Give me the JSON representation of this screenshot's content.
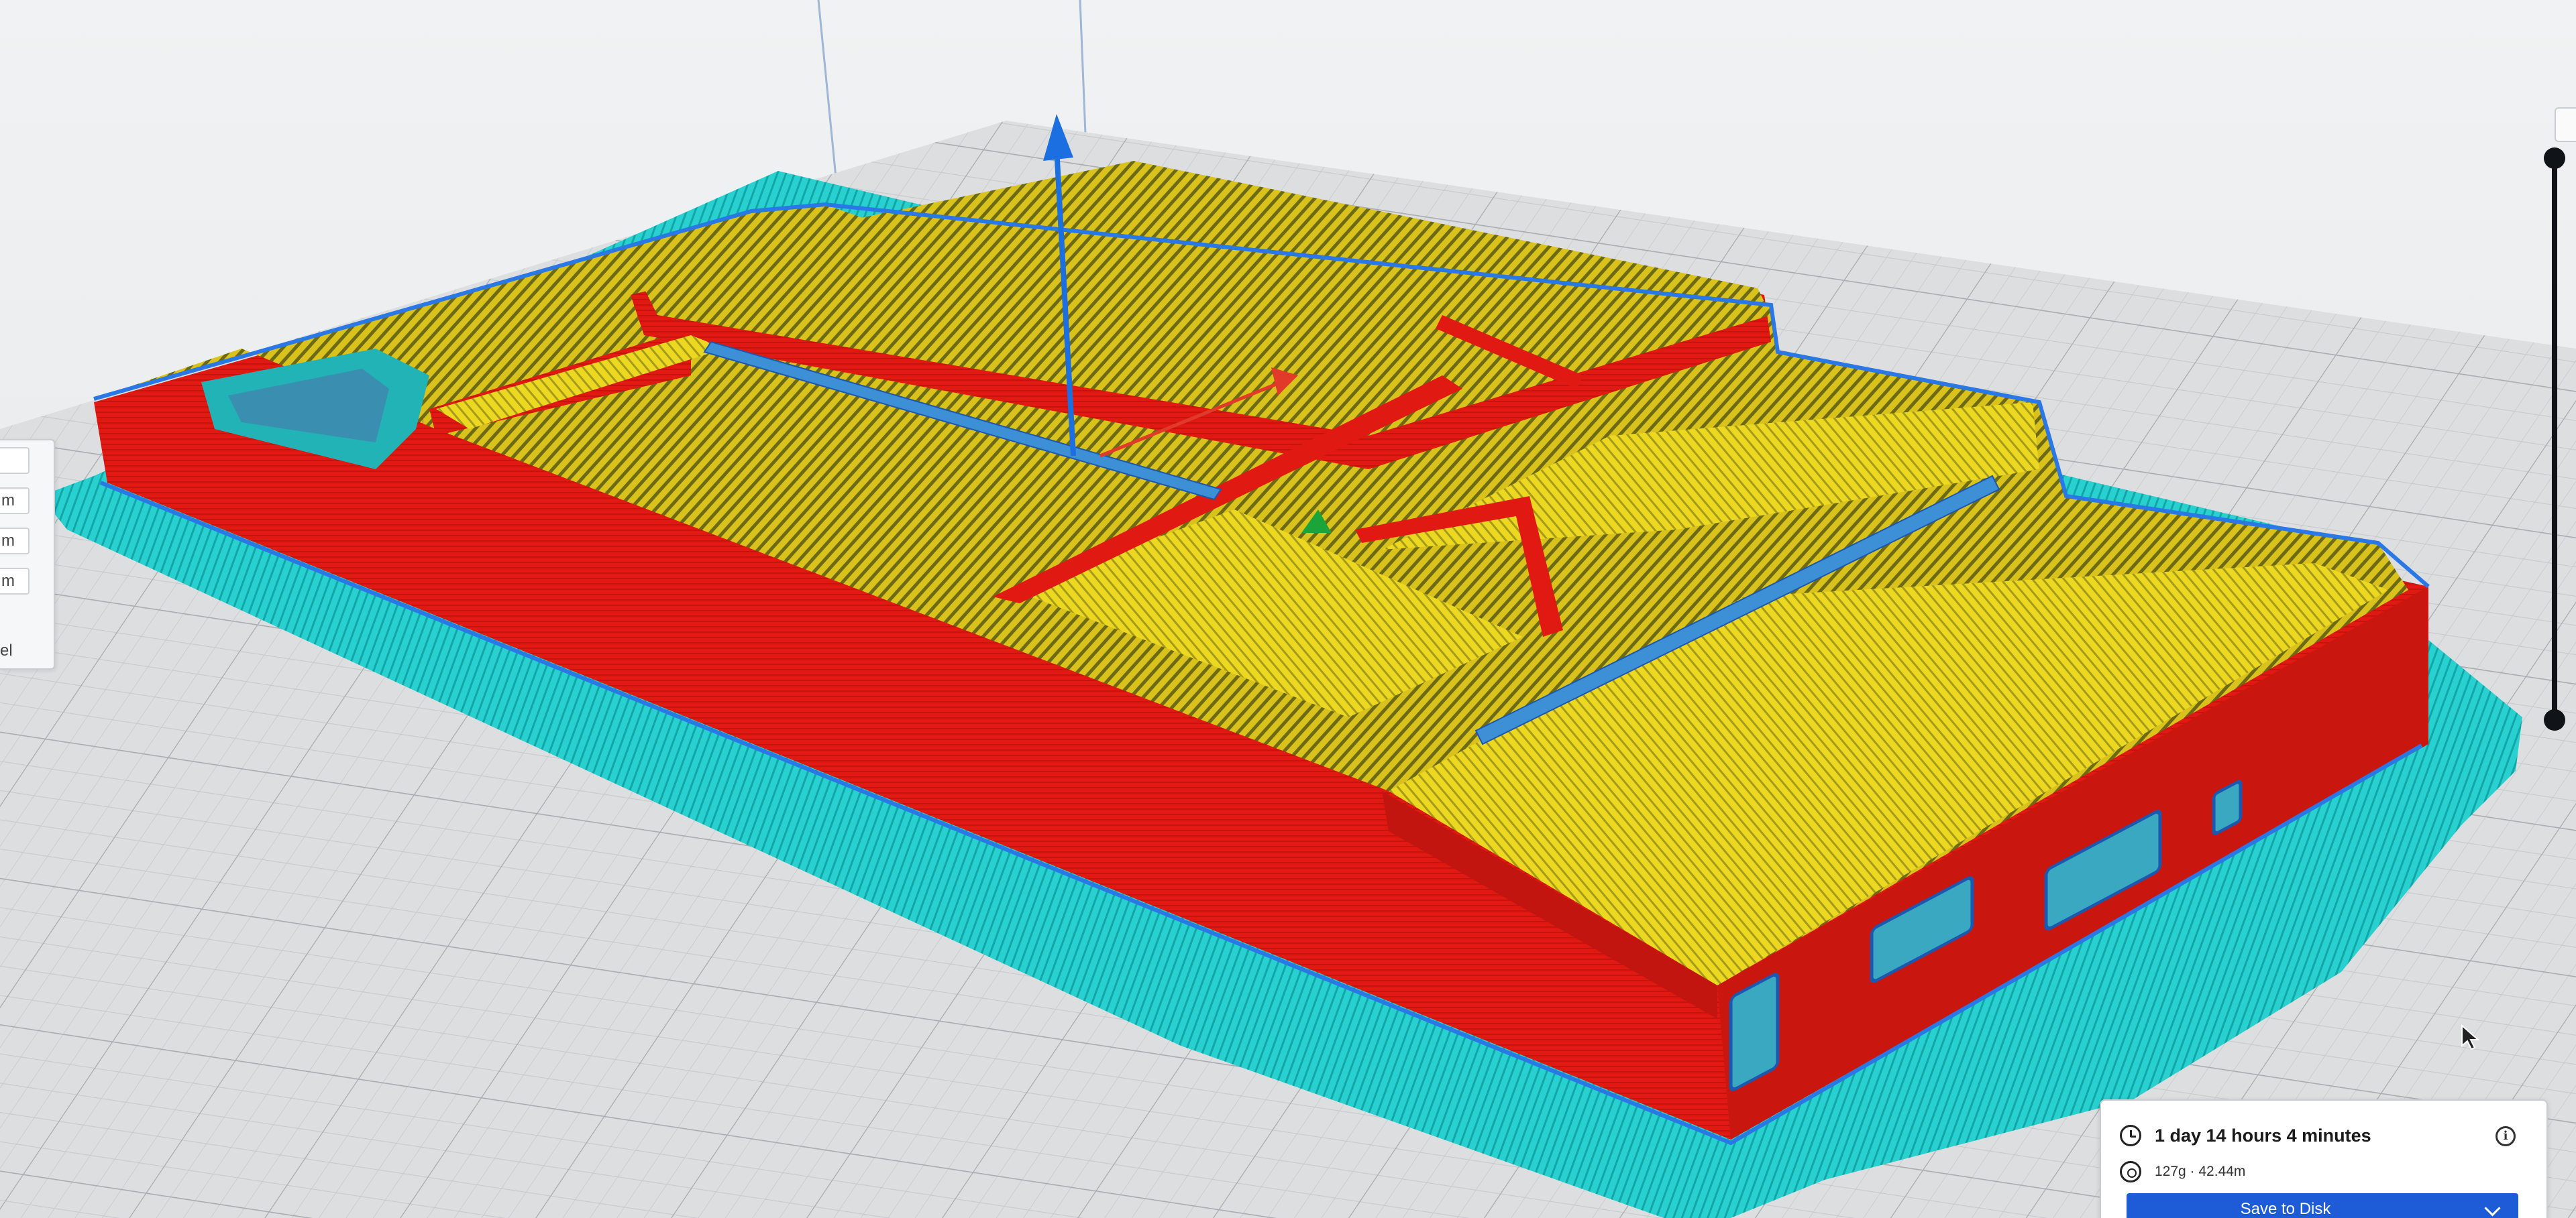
{
  "print_info": {
    "time": "1 day 14 hours 4 minutes",
    "material": "127g · 42.44m",
    "save_button": "Save to Disk",
    "icons": {
      "time": "clock-icon",
      "material": "spool-icon",
      "info": "info-icon",
      "dropdown": "chevron-down-icon"
    }
  },
  "left_panel": {
    "units": [
      "",
      "m",
      "m",
      "m"
    ],
    "tail": "el"
  },
  "colors": {
    "wall": "#e01a12",
    "top_skin": "#e3d21a",
    "support": "#1fc8c8",
    "outline": "#2a78e6",
    "accent_button": "#1e5bd6",
    "axis_z": "#1c6fe0",
    "axis_x": "#e23a2a",
    "axis_y": "#1aa43a"
  }
}
